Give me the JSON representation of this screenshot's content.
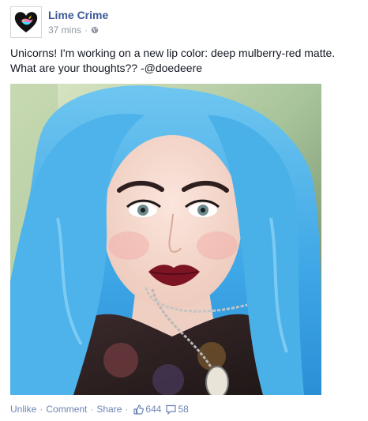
{
  "page": {
    "name": "Lime Crime",
    "time": "37 mins",
    "privacy_icon": "globe-icon",
    "avatar_icon": "unicorn-heart-logo"
  },
  "post": {
    "text": "Unicorns! I'm working on a new lip color: deep mulberry-red matte. What are your thoughts?? -@doedeere"
  },
  "actions": {
    "unlike": "Unlike",
    "comment": "Comment",
    "share": "Share",
    "separator": "·",
    "likes_count": "644",
    "comments_count": "58",
    "like_icon": "thumbs-up-icon",
    "comment_icon": "speech-bubble-icon"
  },
  "colors": {
    "link": "#3b5998",
    "meta": "#9197a3",
    "action_link": "#6d84b4"
  }
}
